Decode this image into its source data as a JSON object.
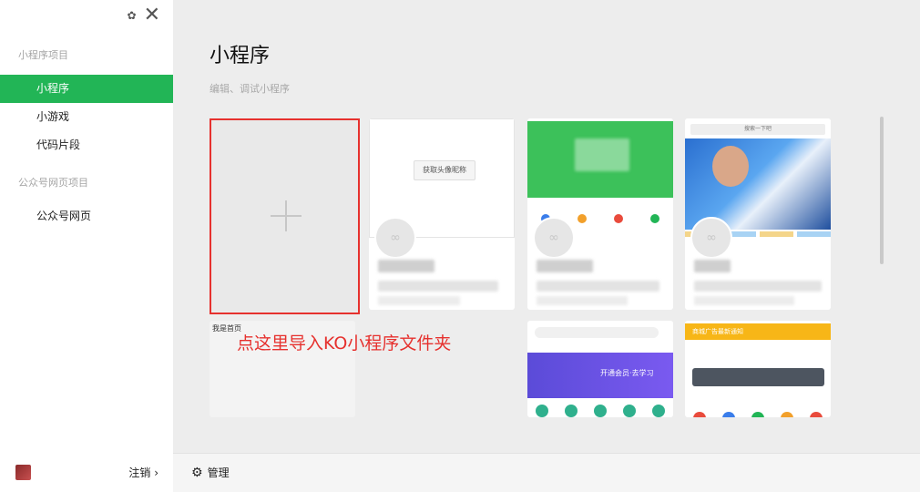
{
  "sidebar": {
    "group_miniprogram": "小程序项目",
    "items": [
      "小程序",
      "小游戏",
      "代码片段"
    ],
    "group_official": "公众号网页项目",
    "official_items": [
      "公众号网页"
    ],
    "logout": "注销 ›"
  },
  "main": {
    "title": "小程序",
    "subtitle": "编辑、调试小程序",
    "manage_label": "管理",
    "cards": [
      {
        "thumb_text": "获取头像昵称"
      },
      {
        "thumb_text": "我是首页"
      },
      {
        "thumb_text": "搜索一下吧"
      },
      {
        "thumb_text": "开通会员·去学习"
      },
      {
        "thumb_text": "商城广告最新通知"
      }
    ]
  },
  "annotation": "点这里导入KO小程序文件夹",
  "colors": {
    "accent": "#22b556",
    "annotation": "#e6312e"
  }
}
